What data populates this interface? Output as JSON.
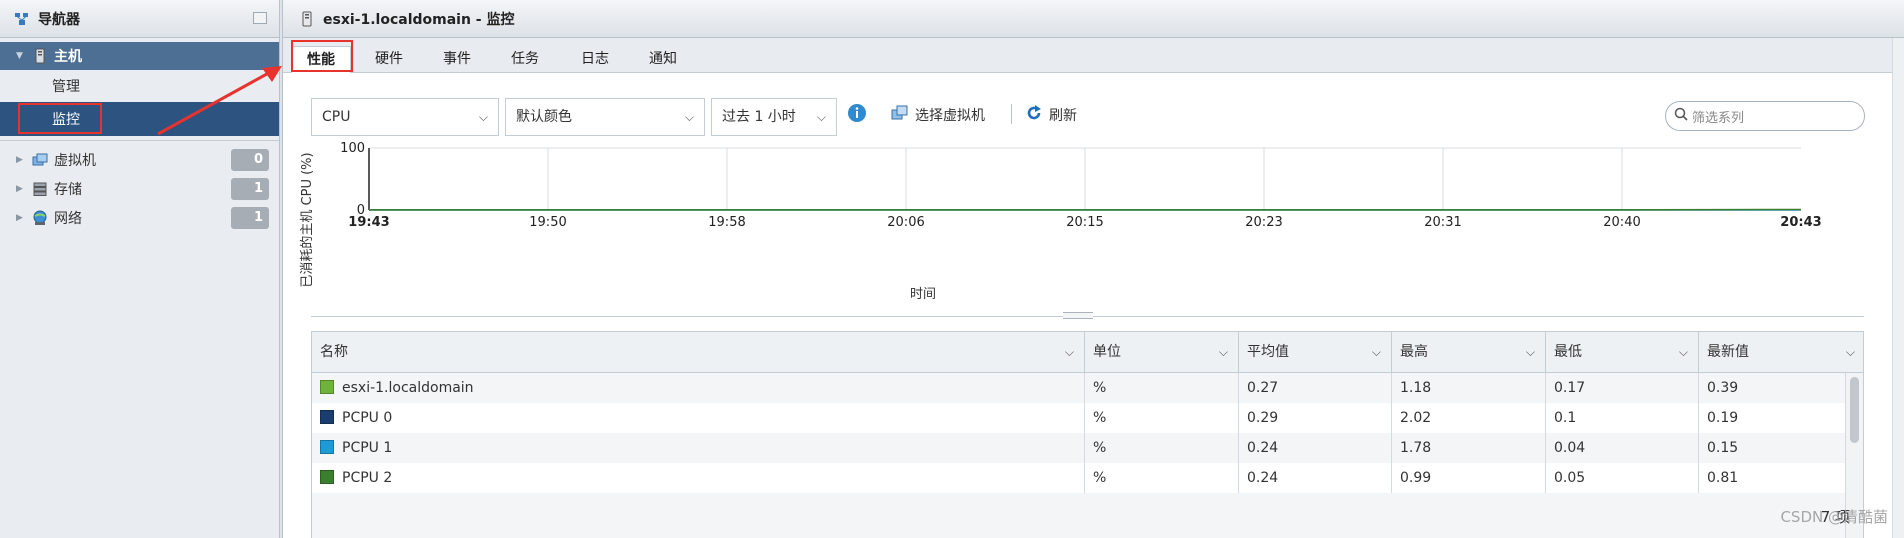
{
  "navigator": {
    "title": "导航器",
    "items": [
      {
        "label": "主机",
        "level": 0,
        "selected": true
      },
      {
        "label": "管理",
        "level": 1
      },
      {
        "label": "监控",
        "level": 1,
        "active": true
      },
      {
        "label": "虚拟机",
        "level": 0,
        "badge": "0"
      },
      {
        "label": "存储",
        "level": 0,
        "badge": "1"
      },
      {
        "label": "网络",
        "level": 0,
        "badge": "1"
      }
    ]
  },
  "main": {
    "title": "esxi-1.localdomain - 监控",
    "tabs": [
      "性能",
      "硬件",
      "事件",
      "任务",
      "日志",
      "通知"
    ],
    "active_tab": "性能"
  },
  "toolbar": {
    "metric_select": "CPU",
    "color_select": "默认颜色",
    "time_select": "过去 1 小时",
    "select_vm_label": "选择虚拟机",
    "refresh_label": "刷新",
    "search_placeholder": "筛选系列"
  },
  "chart_data": {
    "type": "line",
    "title": "",
    "xlabel": "时间",
    "ylabel": "已消耗的主机 CPU (%)",
    "ylim": [
      0,
      100
    ],
    "yticks": [
      "0",
      "100"
    ],
    "x_ticks": [
      "19:43",
      "19:50",
      "19:58",
      "20:06",
      "20:15",
      "20:23",
      "20:31",
      "20:40",
      "20:43"
    ],
    "grid": true,
    "series": [
      {
        "name": "esxi-1.localdomain",
        "color": "#6fb33c",
        "values": [
          0.27,
          0.27,
          0.27,
          0.27,
          0.27,
          0.27,
          0.27,
          0.27,
          0.39
        ]
      },
      {
        "name": "PCPU 0",
        "color": "#1b3c6e",
        "values": [
          0.29,
          0.29,
          0.29,
          0.29,
          0.29,
          0.29,
          0.29,
          0.29,
          0.19
        ]
      },
      {
        "name": "PCPU 1",
        "color": "#1e9bd7",
        "values": [
          0.24,
          0.24,
          0.24,
          0.24,
          0.24,
          0.24,
          0.24,
          0.24,
          0.15
        ]
      },
      {
        "name": "PCPU 2",
        "color": "#3a7f2e",
        "values": [
          0.24,
          0.24,
          0.24,
          0.24,
          0.24,
          0.24,
          0.24,
          0.24,
          0.81
        ]
      }
    ]
  },
  "table": {
    "columns": [
      "名称",
      "单位",
      "平均值",
      "最高",
      "最低",
      "最新值"
    ],
    "rows": [
      {
        "name": "esxi-1.localdomain",
        "color": "#6fb33c",
        "unit": "%",
        "avg": "0.27",
        "max": "1.18",
        "min": "0.17",
        "latest": "0.39"
      },
      {
        "name": "PCPU 0",
        "color": "#1b3c6e",
        "unit": "%",
        "avg": "0.29",
        "max": "2.02",
        "min": "0.1",
        "latest": "0.19"
      },
      {
        "name": "PCPU 1",
        "color": "#1e9bd7",
        "unit": "%",
        "avg": "0.24",
        "max": "1.78",
        "min": "0.04",
        "latest": "0.15"
      },
      {
        "name": "PCPU 2",
        "color": "#3a7f2e",
        "unit": "%",
        "avg": "0.24",
        "max": "0.99",
        "min": "0.05",
        "latest": "0.81"
      }
    ],
    "item_count": "7 项"
  },
  "watermark": "CSDN @清酷菌",
  "colors": {
    "accent_selected": "#2d5480",
    "highlight_box": "#e8322e"
  }
}
